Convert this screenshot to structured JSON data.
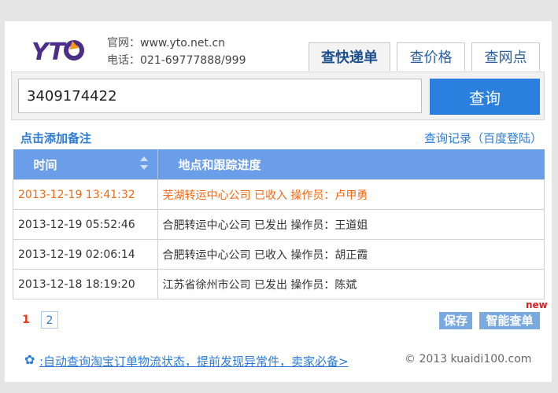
{
  "header": {
    "logo_text": "YTO",
    "site_label": "官网：",
    "site_url": "www.yto.net.cn",
    "phone_label": "电话：",
    "phone": "021-69777888/999"
  },
  "tabs": [
    {
      "label": "查快递单",
      "active": true
    },
    {
      "label": "查价格",
      "active": false
    },
    {
      "label": "查网点",
      "active": false
    }
  ],
  "search": {
    "value": "3409174422",
    "button_label": "查询"
  },
  "links": {
    "add_note": "点击添加备注",
    "history": "查询记录（百度登陆）"
  },
  "table": {
    "headers": [
      "时间",
      "地点和跟踪进度"
    ],
    "rows": [
      {
        "time": "2013-12-19 13:41:32",
        "detail": "芜湖转运中心公司 已收入 操作员：卢甲勇"
      },
      {
        "time": "2013-12-19 05:52:46",
        "detail": "合肥转运中心公司 已发出 操作员：王道姐"
      },
      {
        "time": "2013-12-19 02:06:14",
        "detail": "合肥转运中心公司 已收入 操作员：胡正霞"
      },
      {
        "time": "2013-12-18 18:19:20",
        "detail": "江苏省徐州市公司 已发出 操作员：陈斌"
      }
    ]
  },
  "pagination": {
    "current": "1",
    "other": "2"
  },
  "actions": {
    "new_tag": "new",
    "save": "保存",
    "smart_query": "智能查单"
  },
  "footer": {
    "icon": "flower-icon",
    "promo": ":自动查询淘宝订单物流状态，提前发现异常件，卖家必备>",
    "copyright": "© 2013 kuaidi100.com"
  },
  "colors": {
    "accent": "#2b7fde",
    "header_bg": "#6b9ee8",
    "latest_row": "#f06a17",
    "link": "#2c7bd6"
  }
}
